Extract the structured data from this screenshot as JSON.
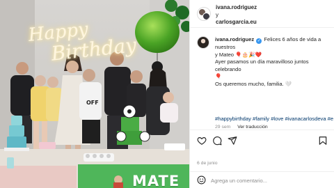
{
  "photo": {
    "neon_sign": {
      "line1": "Happy",
      "line2": "Birthday"
    },
    "banner_text": "MATE"
  },
  "post": {
    "header": {
      "user1": "ivana.rodriguez",
      "conjunction": "y",
      "user2": "carlosgarcia.eu"
    },
    "caption": {
      "username": "ivana.rodriguez",
      "verified_mark": "✓",
      "text_line1": " Felices 6 años de vida a nuestros",
      "text_line2": "y Mateo 🎈🎂🎉❤️",
      "text_line3": "Ayer pasamos un día maravilloso juntos celebrando",
      "text_line4": "🎈",
      "text_line5": "Os queremos mucho, familia. 🤍",
      "hashtags": "#happybirthday #family #love #ivanacarlosdeva #e",
      "time": "29 sem",
      "translate": "Ver traducción"
    },
    "actions": {
      "like_icon": "heart-icon",
      "comment_icon": "comment-icon",
      "share_icon": "share-icon",
      "save_icon": "bookmark-icon"
    },
    "date": "6 de junio",
    "comment": {
      "placeholder": "Agrega un comentario..."
    }
  }
}
